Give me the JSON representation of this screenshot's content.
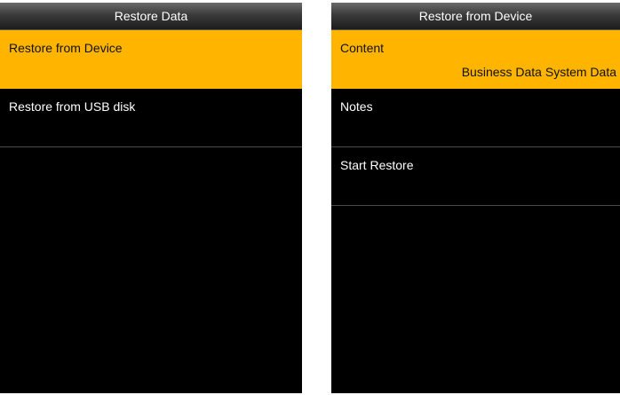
{
  "left_screen": {
    "title": "Restore Data",
    "items": [
      {
        "label": "Restore from Device"
      },
      {
        "label": "Restore from USB disk"
      }
    ]
  },
  "right_screen": {
    "title": "Restore from Device",
    "items": [
      {
        "label": "Content",
        "value": "Business Data System Data"
      },
      {
        "label": "Notes"
      },
      {
        "label": "Start Restore"
      }
    ]
  },
  "colors": {
    "highlight": "#ffb400",
    "background": "#000000"
  }
}
